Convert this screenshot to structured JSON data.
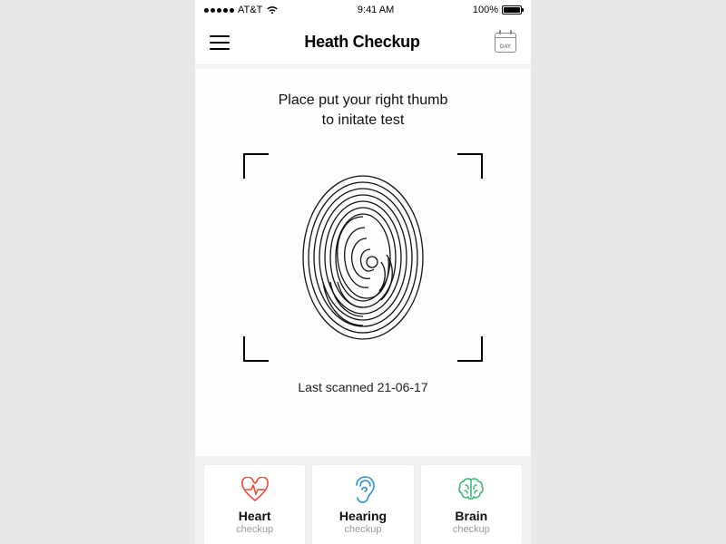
{
  "statusbar": {
    "carrier": "AT&T",
    "time": "9:41 AM",
    "battery_pct": "100%"
  },
  "header": {
    "title": "Heath Checkup",
    "calendar_label": "DAY"
  },
  "main": {
    "instruction_line1": "Place put your right thumb",
    "instruction_line2": "to initate test",
    "last_scanned": "Last scanned 21-06-17"
  },
  "cards": [
    {
      "label": "Heart",
      "sub": "checkup",
      "icon": "heart-ecg-icon",
      "color": "#e74c3c"
    },
    {
      "label": "Hearing",
      "sub": "checkup",
      "icon": "ear-icon",
      "color": "#2d8fd6"
    },
    {
      "label": "Brain",
      "sub": "checkup",
      "icon": "brain-icon",
      "color": "#2eb872"
    }
  ]
}
